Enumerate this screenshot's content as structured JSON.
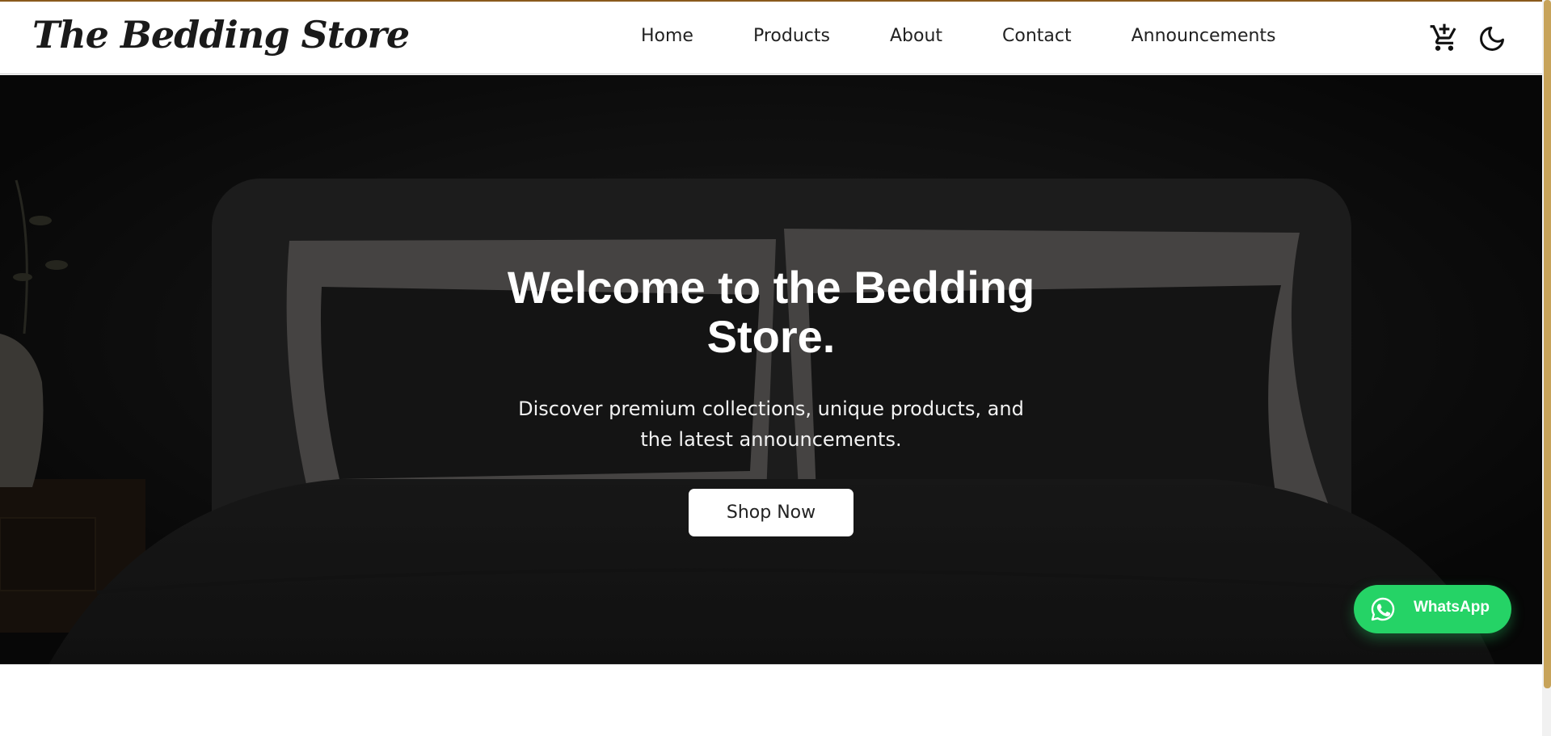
{
  "colors": {
    "accent": "#8a5a1c",
    "scrollbar_thumb": "#c7a35a",
    "whatsapp_green": "#25d366",
    "hero_bg": "#0d0d0d"
  },
  "header": {
    "logo": "The Bedding Store",
    "nav": [
      "Home",
      "Products",
      "About",
      "Contact",
      "Announcements"
    ],
    "icons": [
      "cart-add-icon",
      "moon-icon"
    ]
  },
  "hero": {
    "title": "Welcome to the Bedding Store.",
    "subtitle": "Discover premium collections, unique products, and the latest announcements.",
    "cta_label": "Shop Now"
  },
  "whatsapp": {
    "label": "WhatsApp",
    "icon": "whatsapp-icon"
  }
}
